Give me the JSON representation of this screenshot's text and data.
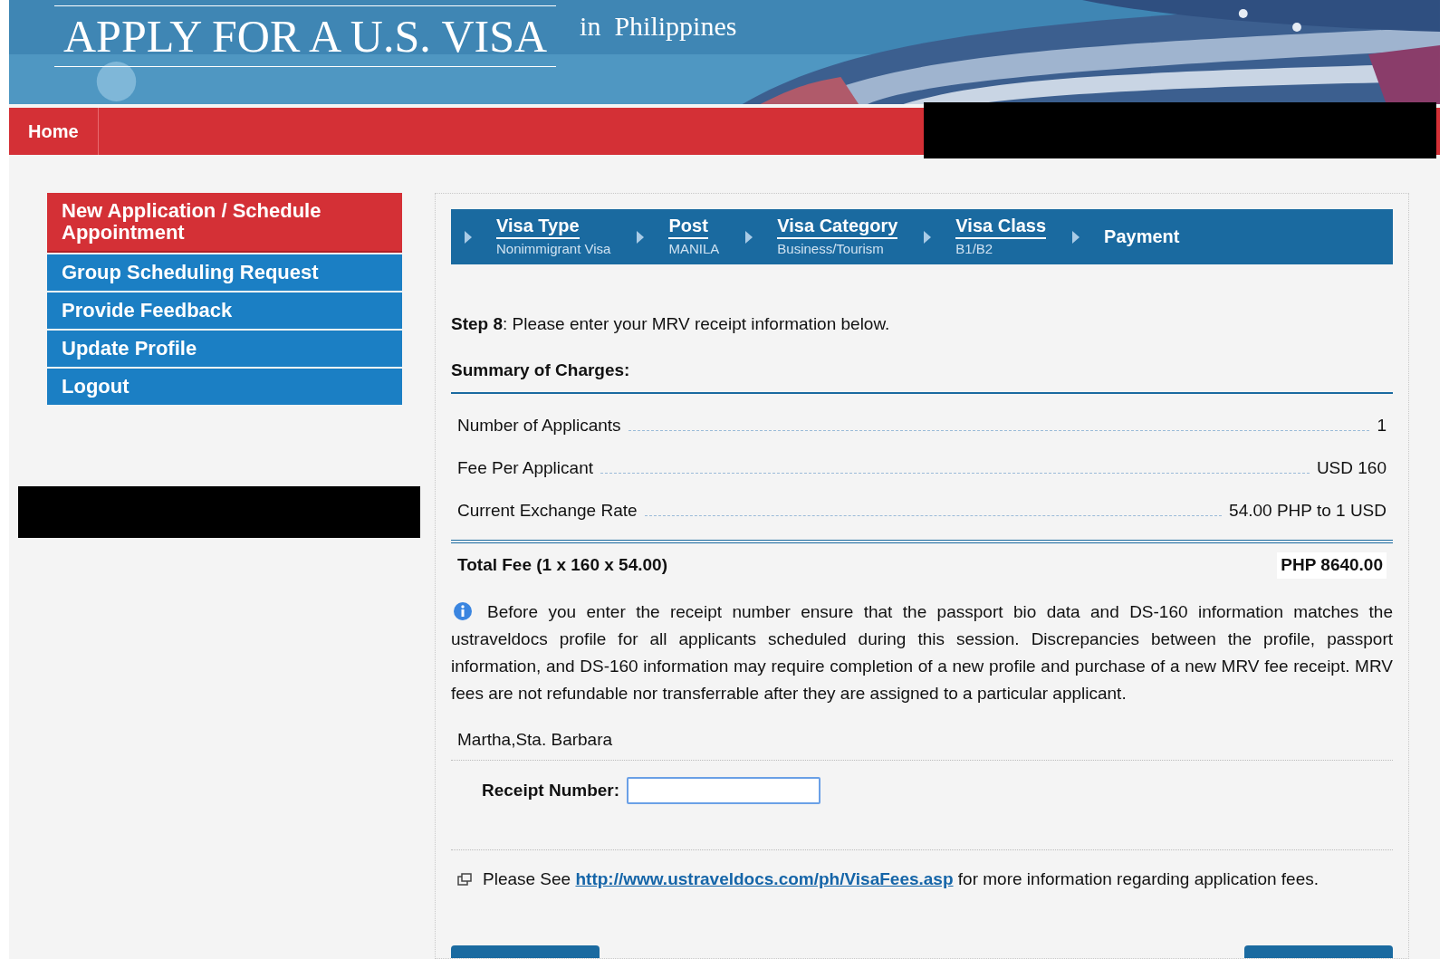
{
  "header": {
    "title": "APPLY FOR A U.S. VISA",
    "subtitle": "in  Philippines"
  },
  "nav": {
    "items": [
      {
        "label": "Home",
        "selected": false
      }
    ]
  },
  "sidebar": {
    "items": [
      {
        "label": "New Application / Schedule Appointment",
        "selected": true
      },
      {
        "label": "Group Scheduling Request",
        "selected": false
      },
      {
        "label": "Provide Feedback",
        "selected": false
      },
      {
        "label": "Update Profile",
        "selected": false
      },
      {
        "label": "Logout",
        "selected": false
      }
    ]
  },
  "steps": [
    {
      "label": "Visa Type",
      "value": "Nonimmigrant Visa",
      "selected": false
    },
    {
      "label": "Post",
      "value": "MANILA",
      "selected": false
    },
    {
      "label": "Visa Category",
      "value": "Business/Tourism",
      "selected": false
    },
    {
      "label": "Visa Class",
      "value": "B1/B2",
      "selected": false
    },
    {
      "label": "Payment",
      "selected": true
    }
  ],
  "step_text": "**Step 8**: Please enter your MRV receipt information below.",
  "summary_title": "Summary of Charges:",
  "charges": [
    {
      "label": "Number of Applicants",
      "value": "1"
    },
    {
      "label": "Fee Per Applicant",
      "value": "USD 160"
    },
    {
      "label": "Current Exchange Rate",
      "value": "54.00 PHP to 1 USD"
    }
  ],
  "total": {
    "label": "Total Fee (1 x 160 x 54.00)",
    "value": "PHP 8640.00"
  },
  "notice": "Before you enter the receipt number ensure that the passport bio data and DS-160 information matches the ustraveldocs profile for all applicants scheduled during this session. Discrepancies between the profile, passport information, and DS-160 information may require completion of a new profile and purchase of a new MRV fee receipt. MRV fees are not refundable nor transferrable after they are assigned to a particular applicant.",
  "applicant": "Martha,Sta. Barbara",
  "receipt": {
    "label": "Receipt Number:"
  },
  "fees_note": {
    "before": "Please See",
    "link": "http://www.ustraveldocs.com/ph/VisaFees.asp",
    "after": "for more information regarding application fees."
  }
}
